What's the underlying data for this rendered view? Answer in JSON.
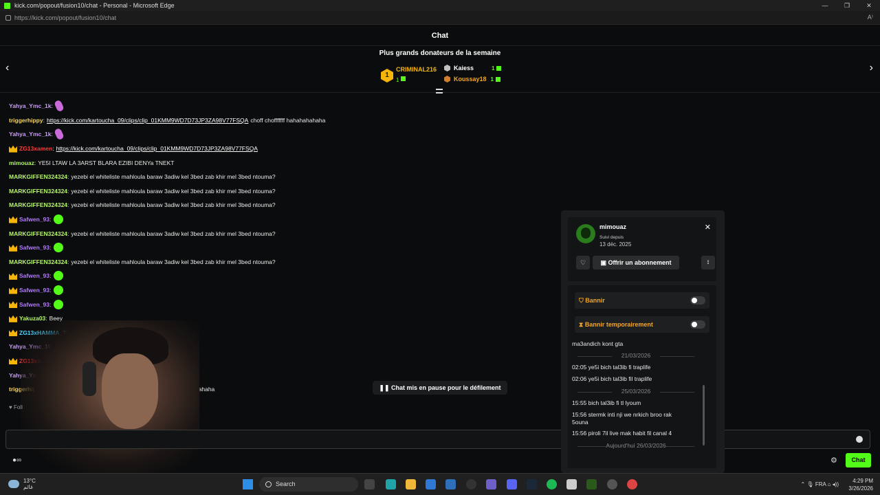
{
  "window": {
    "title": "kick.com/popout/fusion10/chat - Personal - Microsoft Edge",
    "url": "https://kick.com/popout/fusion10/chat",
    "controls": [
      "—",
      "❐",
      "✕"
    ]
  },
  "chat_header": {
    "title": "Chat"
  },
  "donors": {
    "title": "Plus grands donateurs de la semaine",
    "first": {
      "rank": "1",
      "name": "CRIMINAL216",
      "count": "1"
    },
    "second": {
      "name": "Kaiess",
      "count": "1"
    },
    "third": {
      "name": "Koussay18",
      "count": "1"
    },
    "prev_arrow": "‹",
    "next_arrow": "›"
  },
  "messages": [
    {
      "user": "Yahya_Ymc_1k",
      "color": "#c99cf5",
      "crown": false,
      "emote": "pink"
    },
    {
      "user": "triggerhippy",
      "color": "#f7d560",
      "crown": false,
      "link": "https://kick.com/kartoucha_09/clips/clip_01KMM9WD7D73JP3ZA98V77FSQA",
      "text": "choff chofffffff hahahahahaha"
    },
    {
      "user": "Yahya_Ymc_1k",
      "color": "#c99cf5",
      "crown": false,
      "emote": "pink"
    },
    {
      "user": "ZG13xamen",
      "color": "#ff3b3b",
      "crown": true,
      "link": "https://kick.com/kartoucha_09/clips/clip_01KMM9WD7D73JP3ZA98V77FSQA"
    },
    {
      "user": "mimouaz",
      "color": "#b6f56a",
      "crown": false,
      "text": "YE5I LTAW LA 3ARST BLARA EZIBI DENYa TNEKT"
    },
    {
      "user": "MARKGIFFEN324324",
      "color": "#b6f56a",
      "crown": false,
      "text": "yezebi el whiteliste mahloula baraw 3adiw kel 3bed zab khir mel 3bed ntouma?"
    },
    {
      "user": "MARKGIFFEN324324",
      "color": "#b6f56a",
      "crown": false,
      "text": "yezebi el whiteliste mahloula baraw 3adiw kel 3bed zab khir mel 3bed ntouma?"
    },
    {
      "user": "MARKGIFFEN324324",
      "color": "#b6f56a",
      "crown": false,
      "text": "yezebi el whiteliste mahloula baraw 3adiw kel 3bed zab khir mel 3bed ntouma?"
    },
    {
      "user": "Safwen_93",
      "color": "#b47aff",
      "crown": true,
      "emote": "green"
    },
    {
      "user": "MARKGIFFEN324324",
      "color": "#b6f56a",
      "crown": false,
      "text": "yezebi el whiteliste mahloula baraw 3adiw kel 3bed zab khir mel 3bed ntouma?"
    },
    {
      "user": "Safwen_93",
      "color": "#b47aff",
      "crown": true,
      "emote": "green"
    },
    {
      "user": "MARKGIFFEN324324",
      "color": "#b6f56a",
      "crown": false,
      "text": "yezebi el whiteliste mahloula baraw 3adiw kel 3bed zab khir mel 3bed ntouma?"
    },
    {
      "user": "Safwen_93",
      "color": "#b47aff",
      "crown": true,
      "emote": "green"
    },
    {
      "user": "Safwen_93",
      "color": "#b47aff",
      "crown": true,
      "emote": "green"
    },
    {
      "user": "Safwen_93",
      "color": "#b47aff",
      "crown": true,
      "emote": "green"
    },
    {
      "user": "Yakuza03",
      "color": "#b6f56a",
      "crown": true,
      "text": "Beey"
    },
    {
      "user": "ZG13xHAMMA_TL",
      "color": "#4fd7ff",
      "crown": true,
      "text": "vchk"
    },
    {
      "user": "Yahya_Ymc_1k",
      "color": "#c99cf5",
      "crown": false
    },
    {
      "user": "ZG13xamen",
      "color": "#ff3b3b",
      "crown": true,
      "link": "/clips/clip_01KMM9WD7D73JP3ZA98V77FSQA"
    },
    {
      "user": "Yahya_Ymc_1k",
      "color": "#c99cf5",
      "crown": false
    },
    {
      "user": "triggerhippy",
      "color": "#f7d560",
      "crown": false,
      "link": "KMM9WD7D73JP3ZA98V77FSQA",
      "text": "choff chofffffff hahahahahaha"
    }
  ],
  "paused_banner": {
    "icon": "pause-icon",
    "label": "Chat mis en pause pour le défilement"
  },
  "follow_hint": "♥ Foll",
  "send_button": "Chat",
  "user_card": {
    "username": "mimouaz",
    "since_label": "Suivi depuis",
    "since_date": "13 déc. 2025",
    "gift_label": "Offrir un abonnement",
    "ban_label": "Bannir",
    "timeout_label": "Bannir temporairement",
    "history": [
      {
        "type": "line",
        "text": "ma3andich kont gta"
      },
      {
        "type": "date",
        "text": "21/03/2026"
      },
      {
        "type": "line",
        "text": "02:05 ye5i bich tal3ib fi traplife"
      },
      {
        "type": "line",
        "text": "02:06 ye5i bich tal3ib fil traplife"
      },
      {
        "type": "date",
        "text": "25/03/2026"
      },
      {
        "type": "line",
        "text": "15:55 bich tal3ib fi tl lyoum"
      },
      {
        "type": "line",
        "text": "15:56 stermk inti nji we nrkich broo rak"
      },
      {
        "type": "line",
        "text": "5ouna"
      },
      {
        "type": "line",
        "text": "15:56 piroli 7il live mak habit fil canal 4"
      },
      {
        "type": "date",
        "text": "Aujourd'hui 26/03/2026"
      }
    ]
  },
  "taskbar": {
    "temp": "13°C",
    "weather_sub": "غائم",
    "search_placeholder": "Search",
    "lang": "FRA",
    "time": "4:29 PM",
    "date": "3/26/2026"
  }
}
